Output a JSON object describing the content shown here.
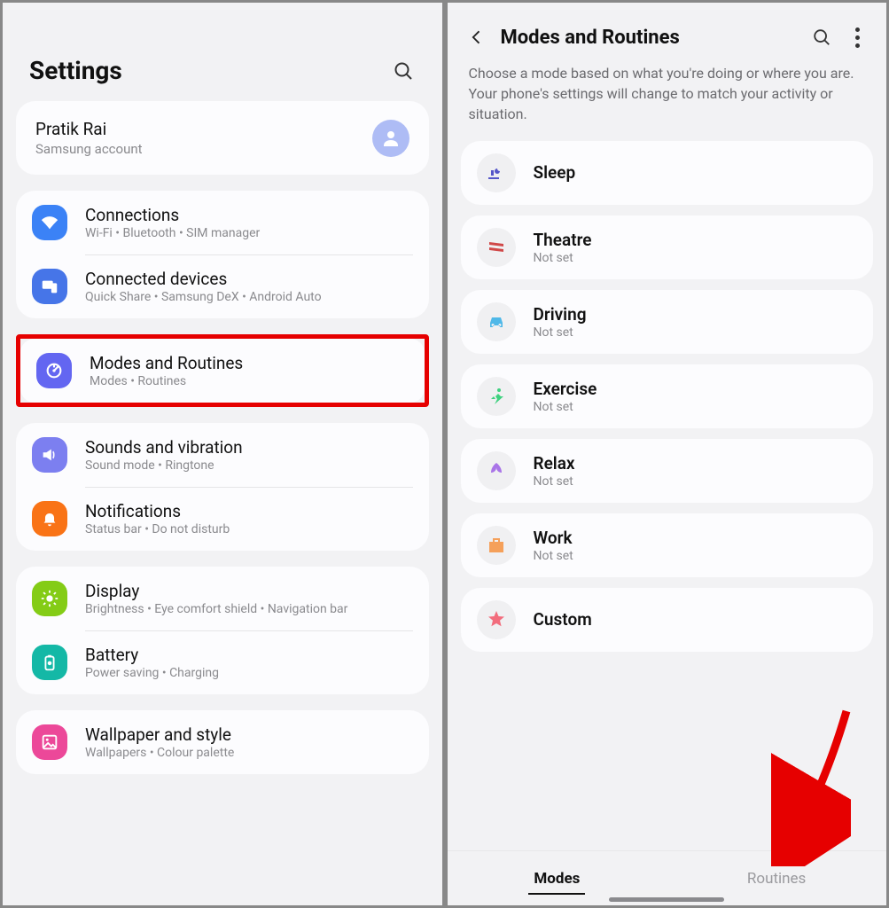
{
  "left": {
    "title": "Settings",
    "account": {
      "name": "Pratik Rai",
      "sub": "Samsung account"
    },
    "groups": [
      {
        "items": [
          {
            "key": "connections",
            "title": "Connections",
            "sub": "Wi-Fi  •  Bluetooth  •  SIM manager",
            "icon": "wifi",
            "color": "ic-blue"
          },
          {
            "key": "connected-devices",
            "title": "Connected devices",
            "sub": "Quick Share  •  Samsung DeX  •  Android Auto",
            "icon": "devices",
            "color": "ic-blue2"
          }
        ]
      },
      {
        "highlighted": true,
        "items": [
          {
            "key": "modes-routines",
            "title": "Modes and Routines",
            "sub": "Modes  •  Routines",
            "icon": "target",
            "color": "ic-purple"
          }
        ]
      },
      {
        "items": [
          {
            "key": "sounds",
            "title": "Sounds and vibration",
            "sub": "Sound mode  •  Ringtone",
            "icon": "speaker",
            "color": "ic-violet"
          },
          {
            "key": "notifications",
            "title": "Notifications",
            "sub": "Status bar  •  Do not disturb",
            "icon": "bell",
            "color": "ic-orange"
          }
        ]
      },
      {
        "items": [
          {
            "key": "display",
            "title": "Display",
            "sub": "Brightness  •  Eye comfort shield  •  Navigation bar",
            "icon": "sun",
            "color": "ic-green"
          },
          {
            "key": "battery",
            "title": "Battery",
            "sub": "Power saving  •  Charging",
            "icon": "battery",
            "color": "ic-teal"
          }
        ]
      },
      {
        "items": [
          {
            "key": "wallpaper",
            "title": "Wallpaper and style",
            "sub": "Wallpapers  •  Colour palette",
            "icon": "image",
            "color": "ic-pink"
          }
        ]
      }
    ]
  },
  "right": {
    "title": "Modes and Routines",
    "description": "Choose a mode based on what you're doing or where you are. Your phone's settings will change to match your activity or situation.",
    "modes": [
      {
        "key": "sleep",
        "title": "Sleep",
        "sub": "",
        "iconClass": "mi-sleep"
      },
      {
        "key": "theatre",
        "title": "Theatre",
        "sub": "Not set",
        "iconClass": "mi-theatre"
      },
      {
        "key": "driving",
        "title": "Driving",
        "sub": "Not set",
        "iconClass": "mi-driving"
      },
      {
        "key": "exercise",
        "title": "Exercise",
        "sub": "Not set",
        "iconClass": "mi-exercise"
      },
      {
        "key": "relax",
        "title": "Relax",
        "sub": "Not set",
        "iconClass": "mi-relax"
      },
      {
        "key": "work",
        "title": "Work",
        "sub": "Not set",
        "iconClass": "mi-work"
      },
      {
        "key": "custom",
        "title": "Custom",
        "sub": "",
        "iconClass": "mi-custom"
      }
    ],
    "tabs": {
      "modes": "Modes",
      "routines": "Routines",
      "active": "modes"
    }
  }
}
